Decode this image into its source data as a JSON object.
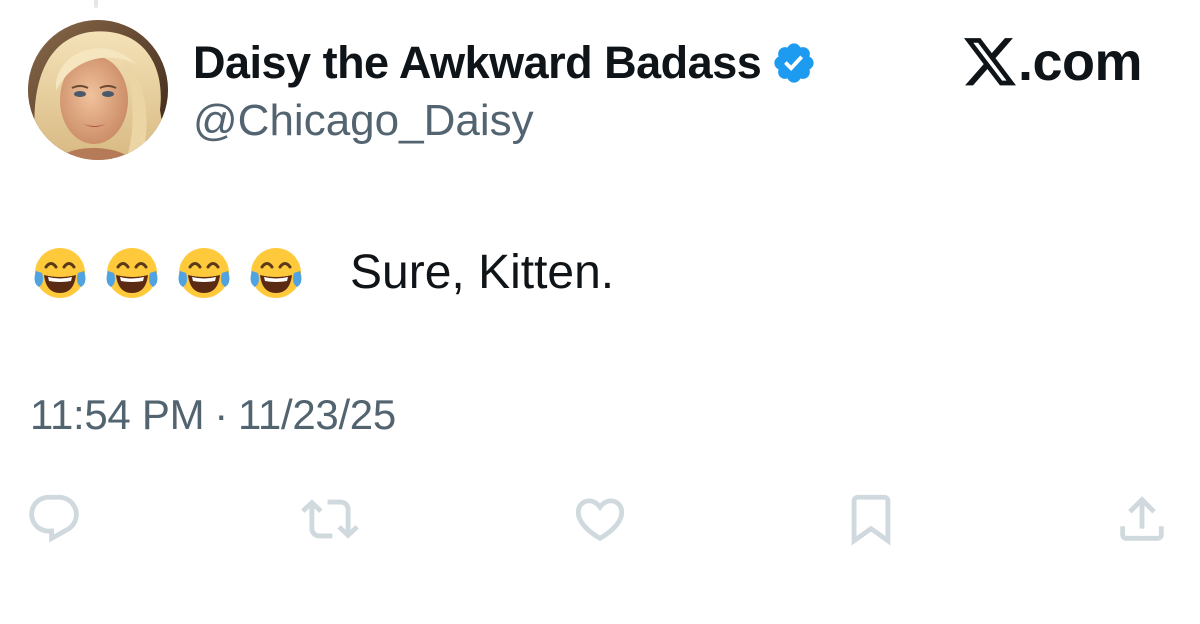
{
  "author": {
    "display_name": "Daisy the Awkward Badass",
    "handle": "@Chicago_Daisy",
    "verified": true,
    "avatar": "avatar-photo"
  },
  "brand": {
    "label": ".com",
    "icon": "x-logo-icon"
  },
  "tweet": {
    "emoji_count": 4,
    "emoji": "face-with-tears-of-joy",
    "text": "Sure, Kitten."
  },
  "meta": {
    "time": "11:54 PM",
    "separator": "·",
    "date": "11/23/25"
  },
  "actions": {
    "icons": [
      "reply-icon",
      "retweet-icon",
      "like-icon",
      "bookmark-icon",
      "share-icon"
    ]
  },
  "colors": {
    "text_primary": "#0f1419",
    "text_secondary": "#536471",
    "verified_blue": "#1d9bf0",
    "action_gray": "#cfd9de"
  }
}
